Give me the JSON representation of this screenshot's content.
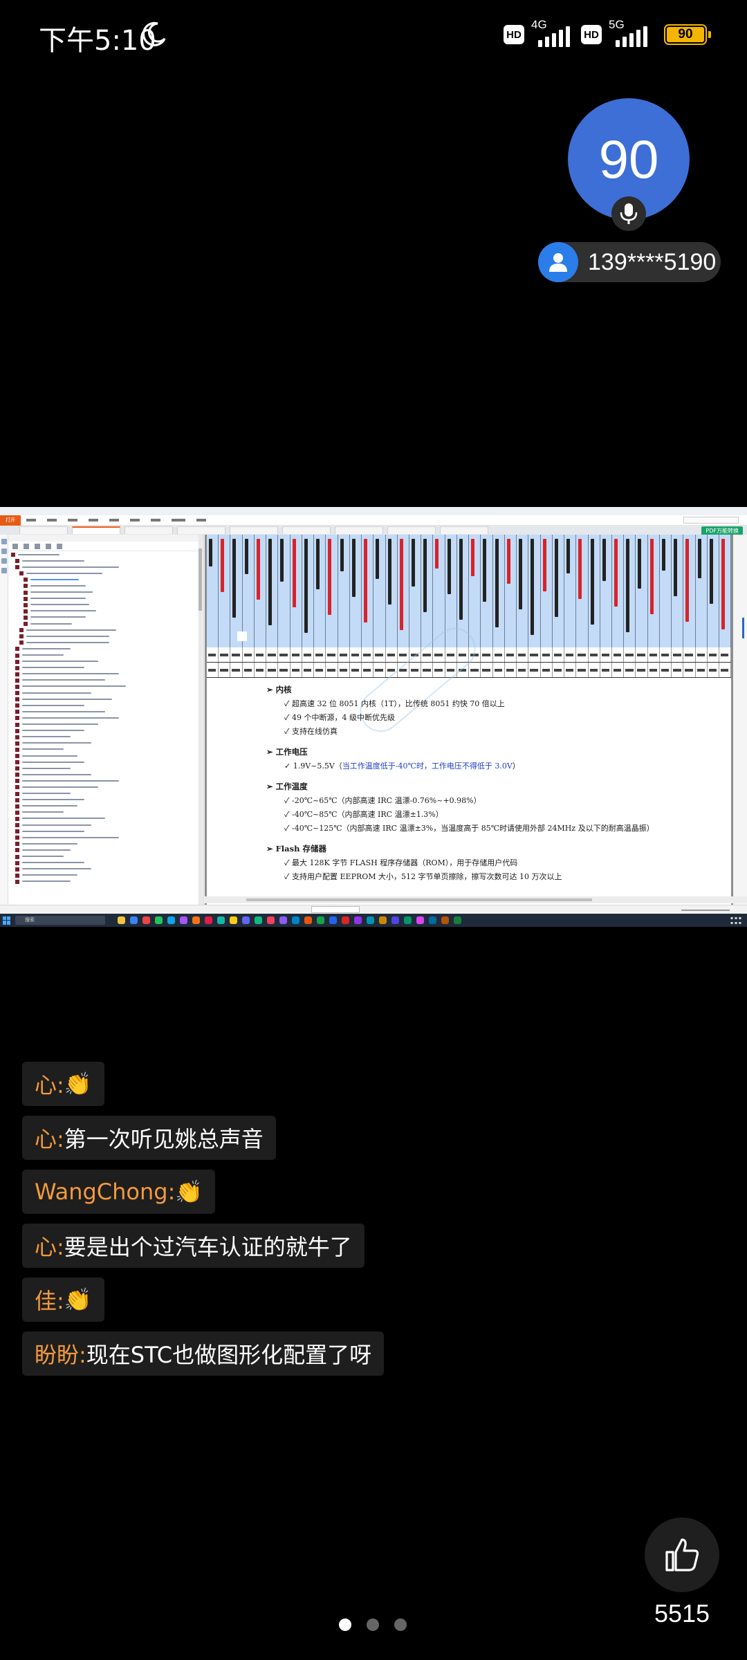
{
  "status_bar": {
    "time": "下午5:10",
    "net1_type": "4G",
    "net2_type": "5G",
    "hd_label": "HD",
    "battery": "90"
  },
  "viewers": {
    "count": "90",
    "phone": "139****5190"
  },
  "shared_screen": {
    "pdf_button": "PDF万能转换",
    "taskbar_search": "搜索",
    "menu_open": "打开"
  },
  "pdf_doc": {
    "core": {
      "heading": "内核",
      "items": [
        "超高速 32 位 8051 内核（1T），比传统 8051 约快 70 倍以上",
        "49 个中断源，4 级中断优先级",
        "支持在线仿真"
      ]
    },
    "voltage": {
      "heading": "工作电压",
      "prefix": "1.9V~5.5V（",
      "note": "当工作温度低于-40℃时，工作电压不得低于 3.0V",
      "suffix": "）"
    },
    "temperature": {
      "heading": "工作温度",
      "items": [
        "-20℃~65℃（内部高速 IRC 温漂-0.76%~+0.98%）",
        "-40℃~85℃（内部高速 IRC 温漂±1.3%）",
        "-40℃~125℃（内部高速 IRC 温漂±3%，当温度高于 85℃时请使用外部 24MHz 及以下的耐高温晶振）"
      ]
    },
    "flash": {
      "heading": "Flash 存储器",
      "items": [
        "最大 128K 字节 FLASH 程序存储器（ROM），用于存储用户代码",
        "支持用户配置 EEPROM 大小，512 字节单页擦除，擦写次数可达 10 万次以上"
      ]
    }
  },
  "chat": {
    "messages": [
      {
        "name": "心:",
        "text": "👏"
      },
      {
        "name": "心:",
        "text": " 第一次听见姚总声音"
      },
      {
        "name": "WangChong:",
        "text": "👏"
      },
      {
        "name": "心:",
        "text": " 要是出个过汽车认证的就牛了"
      },
      {
        "name": "佳:",
        "text": "👏"
      },
      {
        "name": "盼盼:",
        "text": " 现在STC也做图形化配置了呀"
      }
    ]
  },
  "like": {
    "count": "5515",
    "icon": "thumbs-up-icon"
  },
  "pager": {
    "total": 3,
    "current": 1
  },
  "colors": {
    "viewer_badge": "#3d6fd6",
    "chat_name": "#f39a3c",
    "battery": "#f4b500",
    "user_avatar": "#2b7de9"
  }
}
